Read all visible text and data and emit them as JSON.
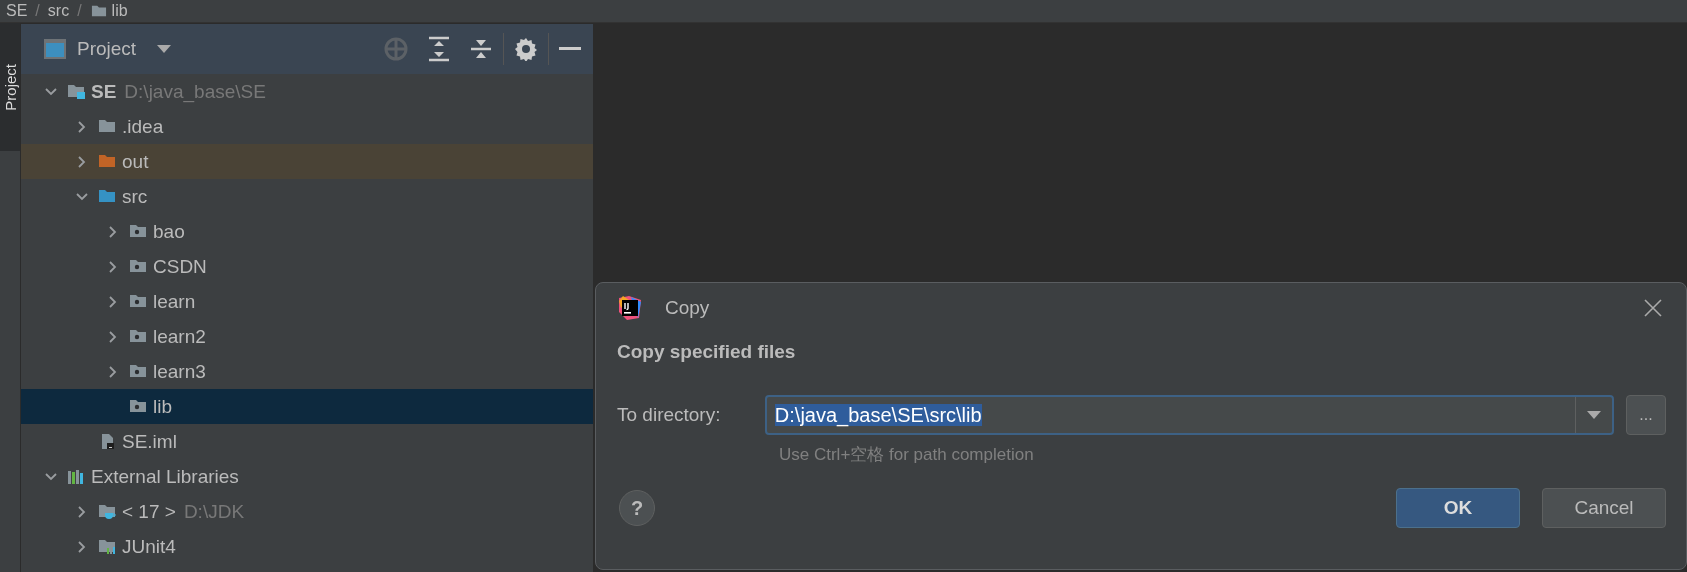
{
  "breadcrumb": [
    {
      "label": "SE",
      "kind": "plain"
    },
    {
      "label": "src",
      "kind": "plain",
      "separator": "/"
    },
    {
      "label": "lib",
      "kind": "folder",
      "separator": "/"
    }
  ],
  "side_tab": {
    "label": "Project",
    "selected": true
  },
  "project_panel": {
    "title": "Project",
    "tree": [
      {
        "label": "SE",
        "path": "D:\\java_base\\SE",
        "kind": "module",
        "expanded": true,
        "selected": false,
        "children": [
          {
            "label": ".idea",
            "kind": "folder",
            "expanded": false,
            "selected": false
          },
          {
            "label": "out",
            "kind": "excluded",
            "expanded": false,
            "selected": false
          },
          {
            "label": "src",
            "kind": "source",
            "expanded": true,
            "selected": false,
            "children": [
              {
                "label": "bao",
                "kind": "package",
                "expanded": false,
                "selected": false
              },
              {
                "label": "CSDN",
                "kind": "package",
                "expanded": false,
                "selected": false
              },
              {
                "label": "learn",
                "kind": "package",
                "expanded": false,
                "selected": false
              },
              {
                "label": "learn2",
                "kind": "package",
                "expanded": false,
                "selected": false
              },
              {
                "label": "learn3",
                "kind": "package",
                "expanded": false,
                "selected": false
              },
              {
                "label": "lib",
                "kind": "package",
                "selected": true
              }
            ]
          },
          {
            "label": "SE.iml",
            "kind": "iml",
            "selected": false
          }
        ]
      },
      {
        "label": "External Libraries",
        "kind": "libraries",
        "expanded": true,
        "selected": false,
        "children": [
          {
            "label": "< 17 >",
            "path": "D:\\JDK",
            "kind": "jdk",
            "expanded": false,
            "selected": false
          },
          {
            "label": "JUnit4",
            "kind": "library",
            "expanded": false,
            "selected": false
          }
        ]
      }
    ]
  },
  "dialog": {
    "title": "Copy",
    "heading": "Copy specified files",
    "field_label": "To directory:",
    "field": {
      "value": "D:\\java_base\\SE\\src\\lib",
      "selected": true
    },
    "hint": "Use Ctrl+空格 for path completion",
    "browse_button": "...",
    "help": "?",
    "buttons": [
      {
        "label": "OK",
        "kind": "primary"
      },
      {
        "label": "Cancel",
        "kind": "secondary"
      }
    ]
  }
}
